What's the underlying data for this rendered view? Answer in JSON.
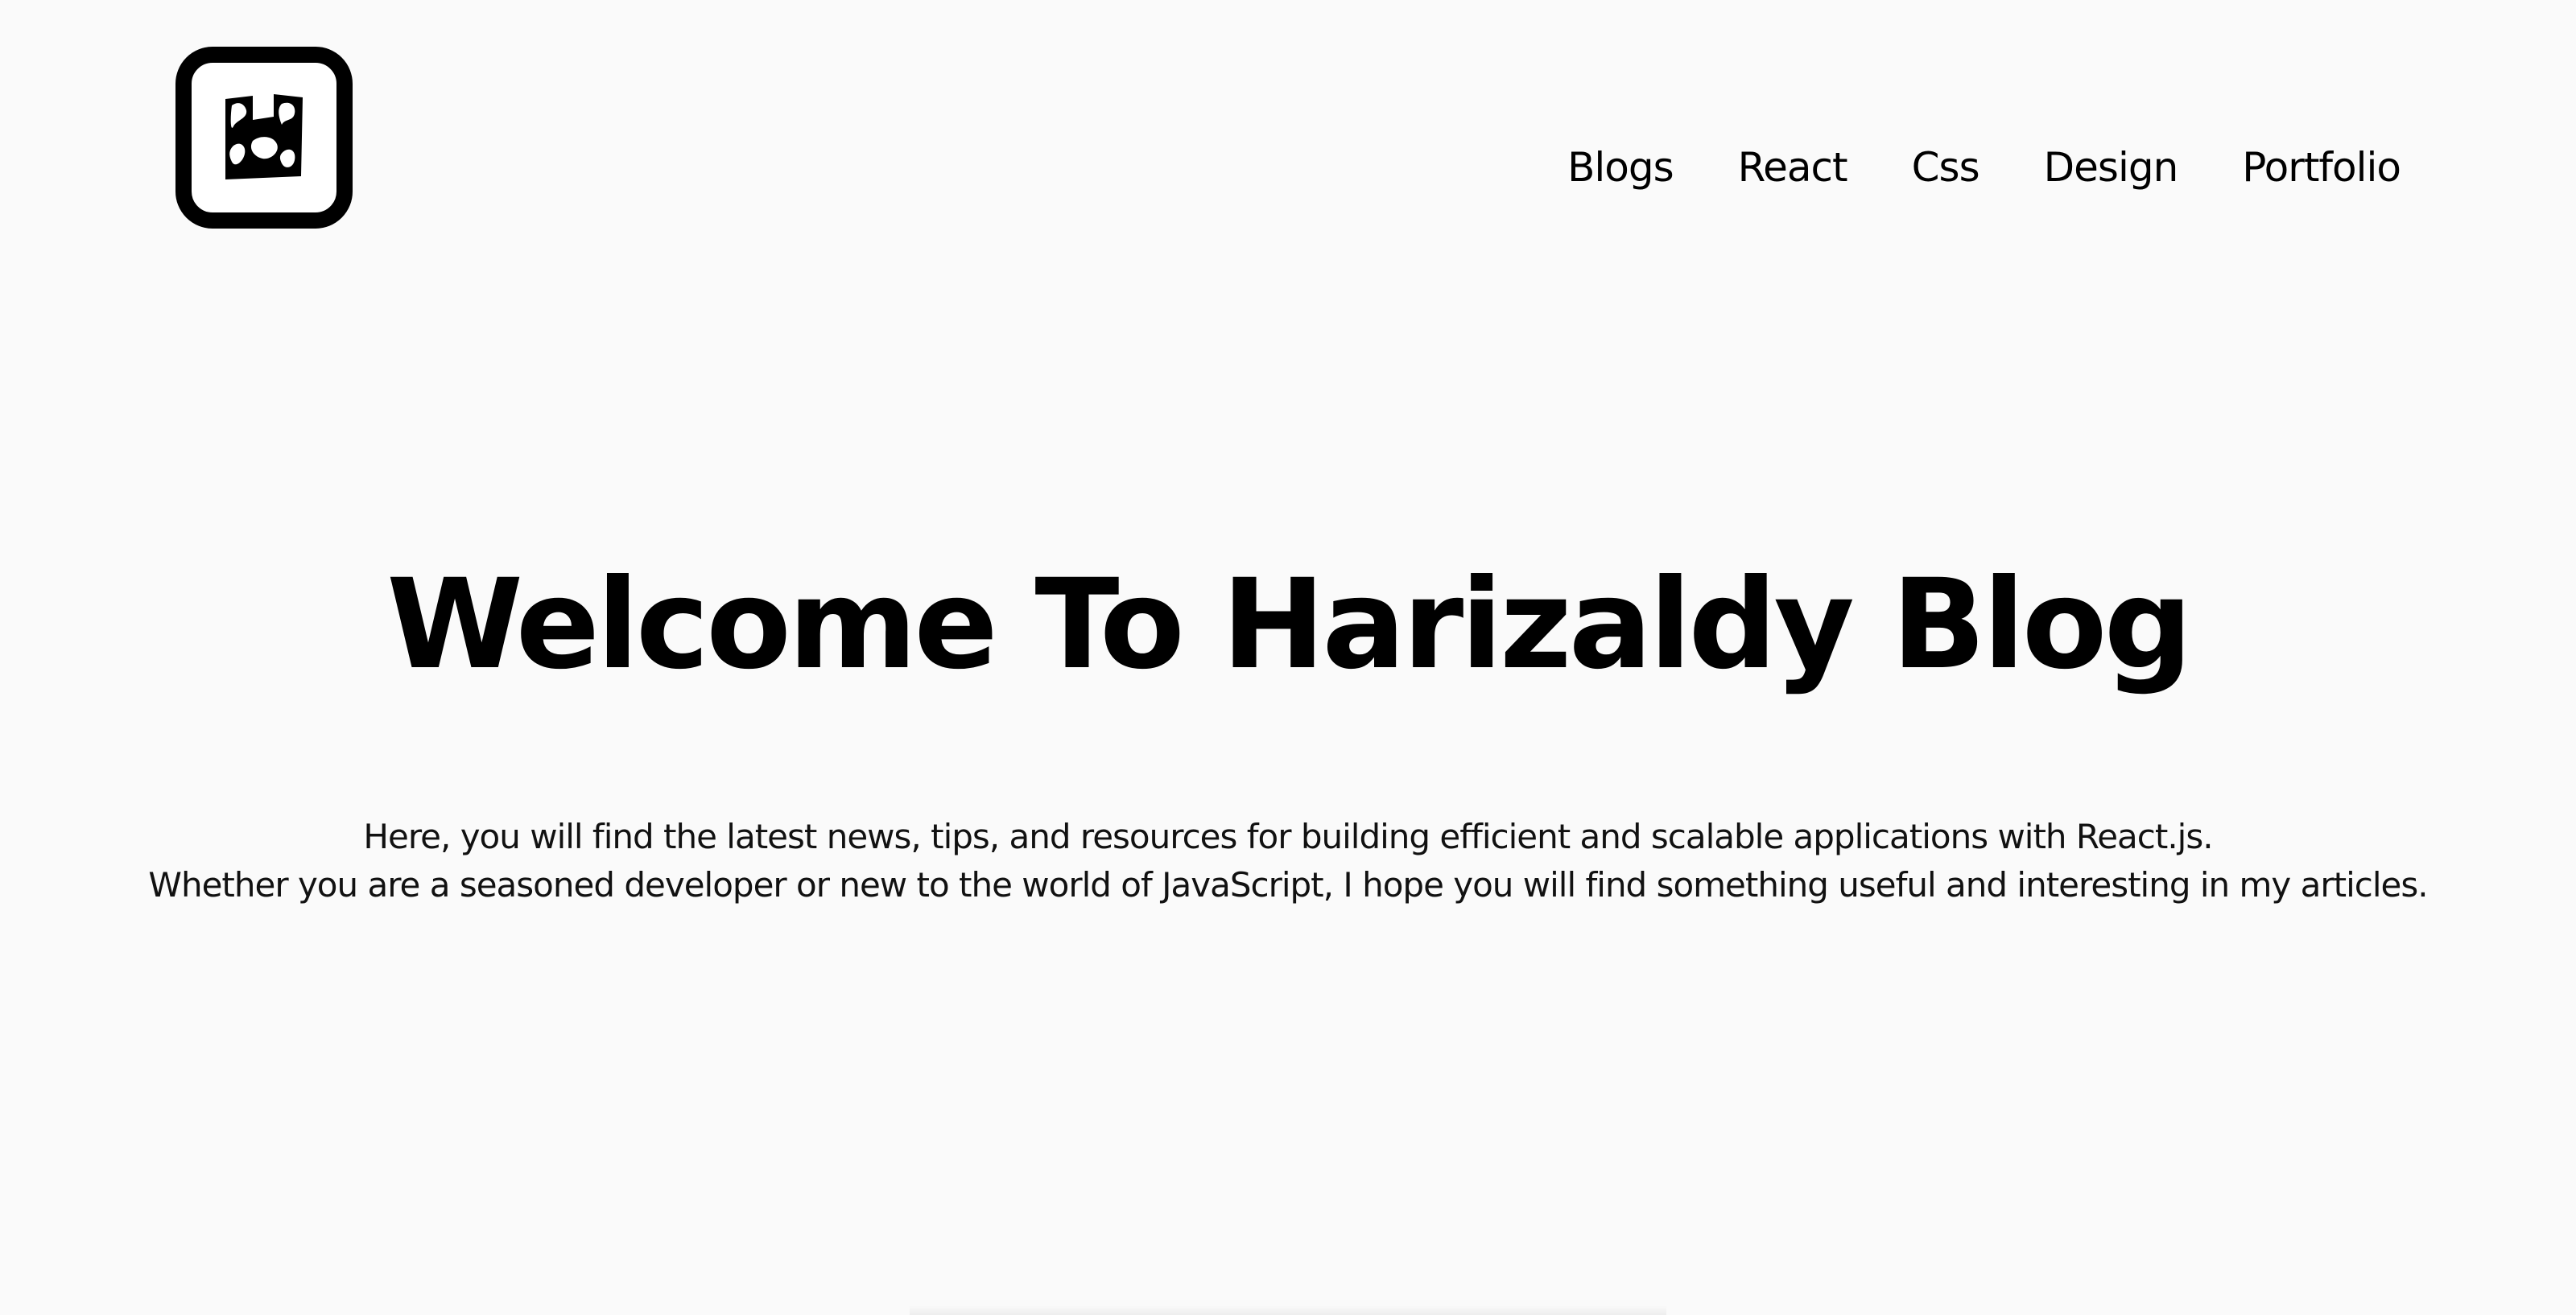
{
  "logo": {
    "icon": "harizaldy-logo-icon"
  },
  "nav": {
    "items": [
      {
        "label": "Blogs"
      },
      {
        "label": "React"
      },
      {
        "label": "Css"
      },
      {
        "label": "Design"
      },
      {
        "label": "Portfolio"
      }
    ]
  },
  "hero": {
    "title": "Welcome To Harizaldy Blog",
    "line1": "Here, you will find the latest news, tips, and resources for building efficient and scalable applications with React.js.",
    "line2": "Whether you are a seasoned developer or new to the world of JavaScript, I hope you will find something useful and interesting in my articles."
  }
}
